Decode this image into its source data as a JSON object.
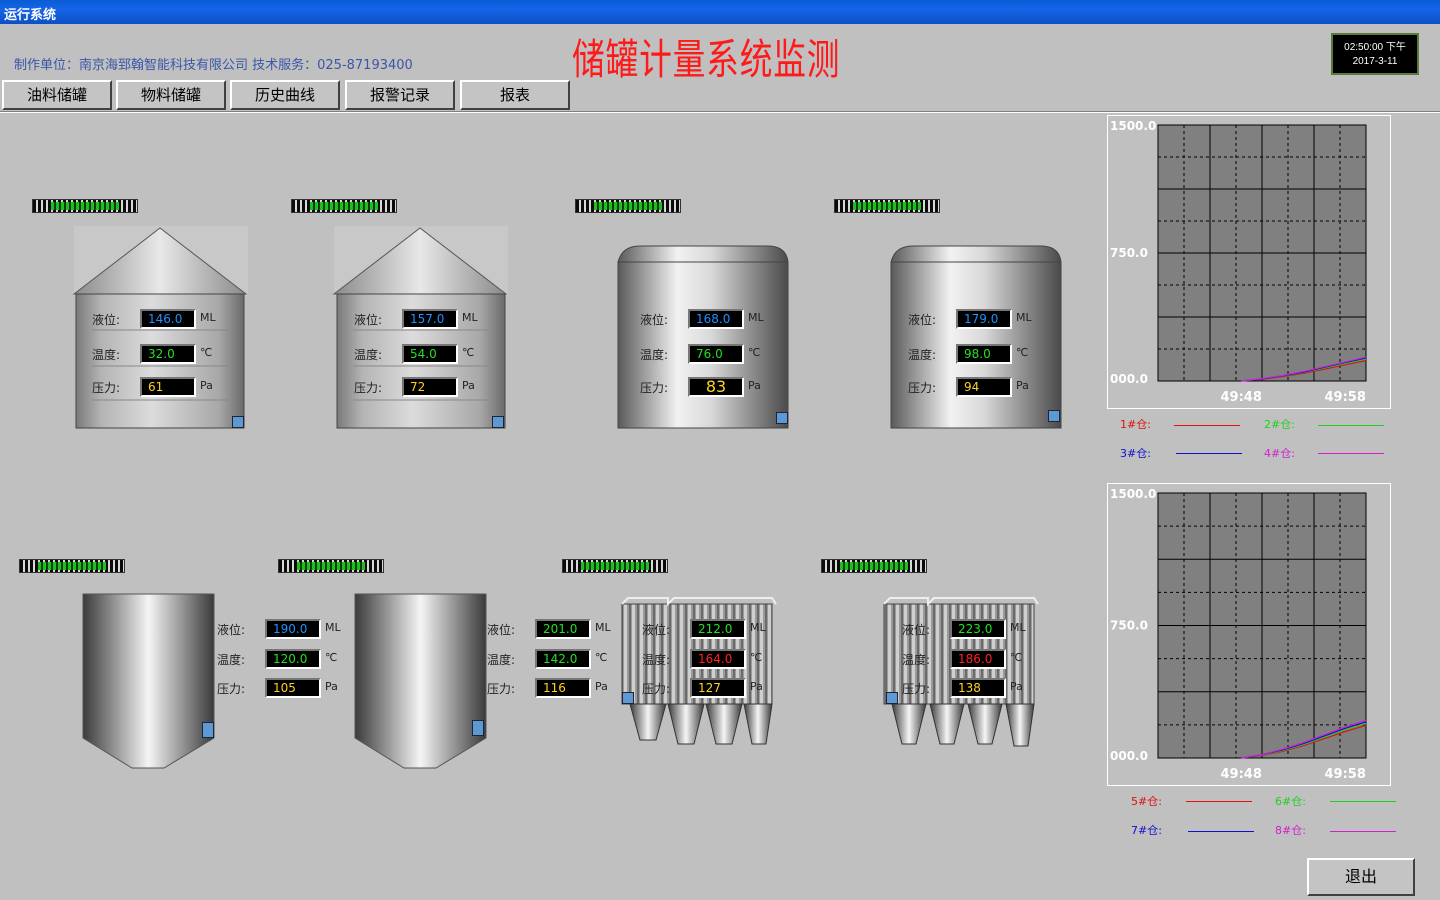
{
  "window_title": "运行系统",
  "header": {
    "company": "制作单位：南京海郅翰智能科技有限公司   技术服务：025-87193400",
    "title": "储罐计量系统监测",
    "clock_time": "02:50:00 下午",
    "clock_date": "2017-3-11"
  },
  "nav": [
    "油料储罐",
    "物料储罐",
    "历史曲线",
    "报警记录",
    "报表"
  ],
  "labels": {
    "level": "液位:",
    "temp": "温度:",
    "pressure": "压力:",
    "unit_level": "ML",
    "unit_temp": "℃",
    "unit_pressure": "Pa"
  },
  "tanks": [
    {
      "level": "146.0",
      "temp": "32.0",
      "pressure": "61"
    },
    {
      "level": "157.0",
      "temp": "54.0",
      "pressure": "72"
    },
    {
      "level": "168.0",
      "temp": "76.0",
      "pressure": "83"
    },
    {
      "level": "179.0",
      "temp": "98.0",
      "pressure": "94"
    },
    {
      "level": "190.0",
      "temp": "120.0",
      "pressure": "105"
    },
    {
      "level": "201.0",
      "temp": "142.0",
      "pressure": "116"
    },
    {
      "level": "212.0",
      "temp": "164.0",
      "pressure": "127"
    },
    {
      "level": "223.0",
      "temp": "186.0",
      "pressure": "138"
    }
  ],
  "colors": {
    "level": "#1e90ff",
    "temp_normal": "#22e022",
    "temp_alarm": "#ff2020",
    "pressure": "#ffd21a",
    "red": "#e01010",
    "green": "#20d020",
    "blue": "#1010d0",
    "magenta": "#d020d0"
  },
  "chart_data": [
    {
      "type": "line",
      "ylim": [
        0,
        1500
      ],
      "yticks": [
        "1500.0",
        "750.0",
        "000.0"
      ],
      "xticks": [
        "49:48",
        "49:58"
      ],
      "series": [
        {
          "name": "1#仓:",
          "color": "#e01010",
          "values": [
            0,
            10,
            25,
            45,
            70,
            95,
            120
          ]
        },
        {
          "name": "2#仓:",
          "color": "#20d020",
          "values": [
            0,
            12,
            28,
            50,
            76,
            102,
            128
          ]
        },
        {
          "name": "3#仓:",
          "color": "#1010d0",
          "values": [
            0,
            12,
            30,
            52,
            80,
            108,
            135
          ]
        },
        {
          "name": "4#仓:",
          "color": "#d020d0",
          "values": [
            0,
            14,
            32,
            56,
            84,
            112,
            140
          ]
        }
      ]
    },
    {
      "type": "line",
      "ylim": [
        0,
        1500
      ],
      "yticks": [
        "1500.0",
        "750.0",
        "000.0"
      ],
      "xticks": [
        "49:48",
        "49:58"
      ],
      "series": [
        {
          "name": "5#仓:",
          "color": "#e01010",
          "values": [
            0,
            14,
            38,
            70,
            110,
            150,
            185
          ]
        },
        {
          "name": "6#仓:",
          "color": "#20d020",
          "values": [
            0,
            16,
            42,
            76,
            118,
            160,
            195
          ]
        },
        {
          "name": "7#仓:",
          "color": "#1010d0",
          "values": [
            0,
            18,
            46,
            82,
            125,
            168,
            205
          ]
        },
        {
          "name": "8#仓:",
          "color": "#d020d0",
          "values": [
            0,
            20,
            50,
            88,
            132,
            175,
            212
          ]
        }
      ]
    }
  ],
  "exit_label": "退出"
}
